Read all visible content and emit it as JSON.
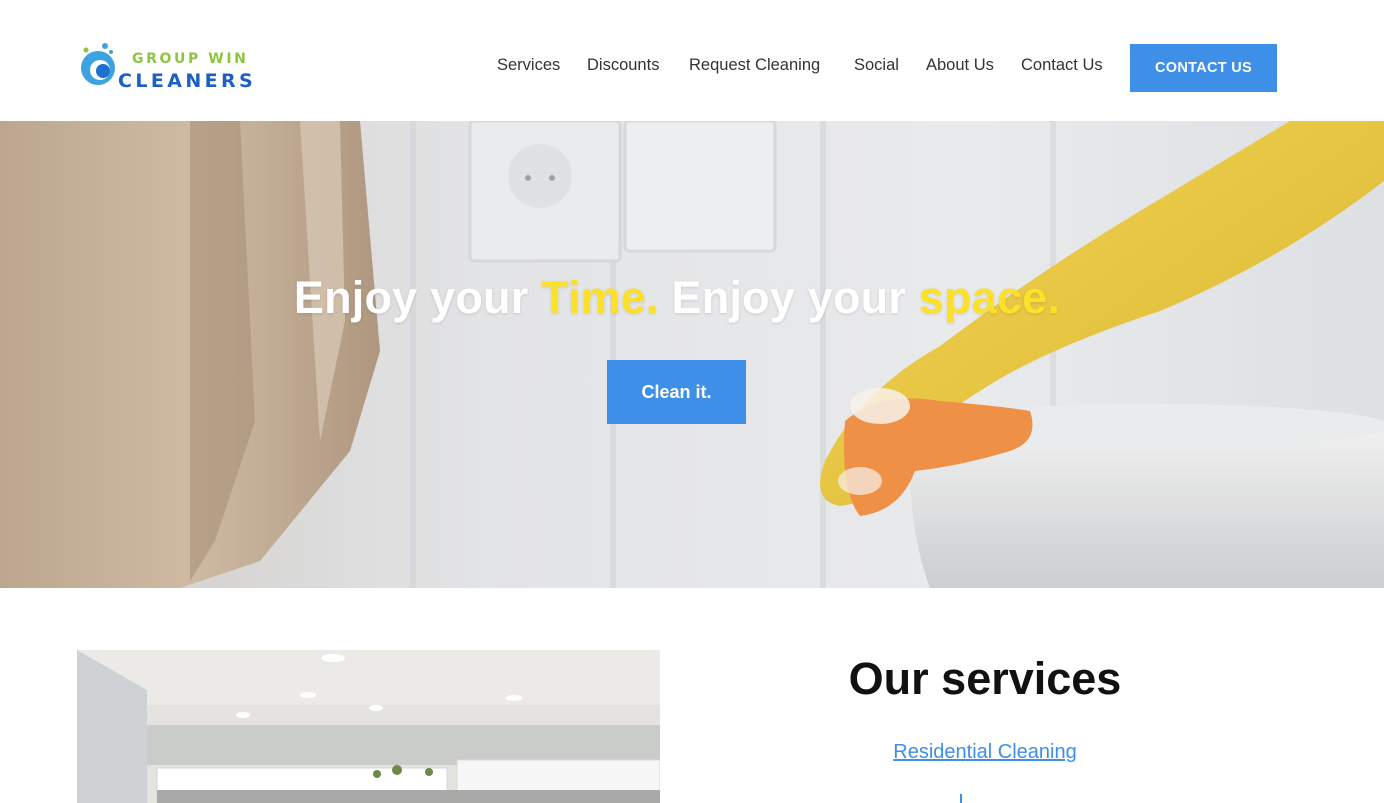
{
  "logo": {
    "line1": "GROUP WIN",
    "line2": "CLEANERS",
    "icon": "water-drop-logo-icon"
  },
  "nav": {
    "items": [
      {
        "label": "Services"
      },
      {
        "label": "Discounts"
      },
      {
        "label": "Request Cleaning"
      },
      {
        "label": "Social"
      },
      {
        "label": "About Us"
      },
      {
        "label": "Contact Us"
      }
    ],
    "cta_label": "CONTACT US"
  },
  "hero": {
    "title_part1": "Enjoy your ",
    "title_hl1": "Time.",
    "title_part2": " Enjoy your ",
    "title_hl2": "space.",
    "button_label": "Clean it."
  },
  "services": {
    "title": "Our services",
    "links": [
      {
        "label": "Residential Cleaning"
      }
    ]
  },
  "colors": {
    "accent": "#3d8fe8",
    "highlight": "#fde02a",
    "logo_green": "#8cc63f",
    "logo_blue": "#1d5fc3"
  }
}
